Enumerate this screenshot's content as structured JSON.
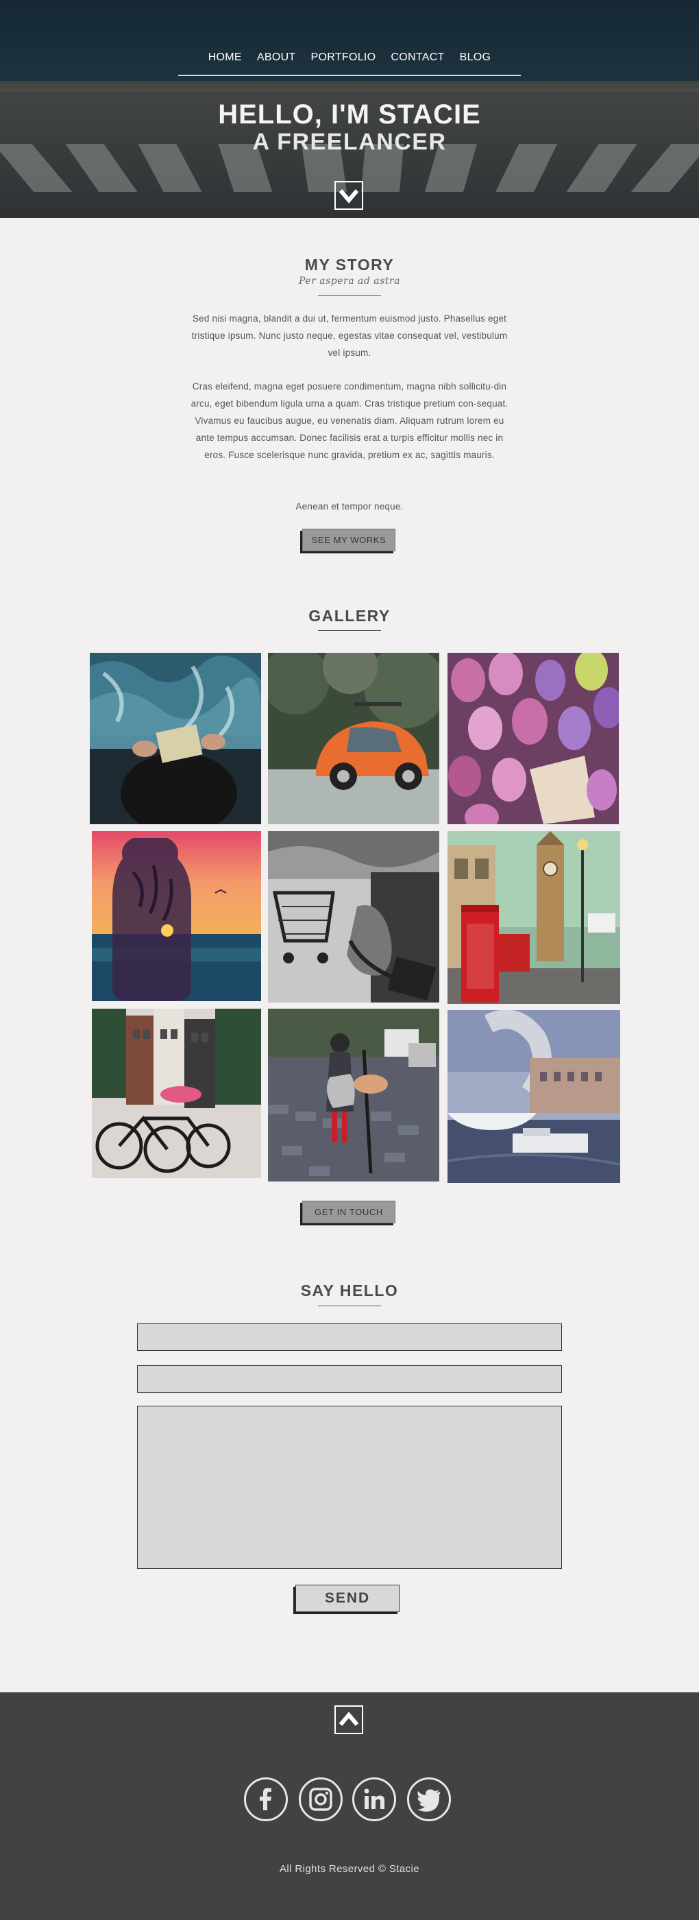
{
  "nav": {
    "items": [
      "HOME",
      "ABOUT",
      "PORTFOLIO",
      "CONTACT",
      "BLOG"
    ]
  },
  "hero": {
    "title": "HELLO, I'M STACIE",
    "subtitle": "A FREELANCER",
    "scroll_down_icon": "chevron-down-icon"
  },
  "story": {
    "title": "MY STORY",
    "motto": "Per aspera ad astra",
    "paragraphs": [
      "Sed nisi magna, blandit a dui ut, fermentum euismod justo. Phasellus eget tristique ipsum. Nunc justo neque, egestas vitae consequat vel, vestibulum vel ipsum.",
      "Cras eleifend, magna eget posuere condimentum, magna nibh sollicitu-din arcu, eget bibendum ligula urna a quam. Cras tristique pretium con-sequat. Vivamus eu faucibus augue, eu venenatis diam. Aliquam rutrum lorem eu ante tempus accumsan. Donec facilisis erat a turpis efficitur mollis nec in eros. Fusce scelerisque nunc gravida, pretium ex ac, sagittis mauris.",
      "Aenean et tempor neque."
    ],
    "button_label": "SEE MY WORKS"
  },
  "gallery": {
    "title": "GALLERY",
    "button_label": "GET IN TOUCH"
  },
  "contact": {
    "title": "SAY HELLO",
    "send_label": "SEND"
  },
  "footer": {
    "scroll_up_icon": "chevron-up-icon",
    "social_icons": [
      "facebook-icon",
      "instagram-icon",
      "linkedin-icon",
      "twitter-icon"
    ],
    "copyright": "All Rights Reserved © Stacie"
  },
  "colors": {
    "background": "#f2f0f1",
    "footer": "#434142",
    "button": "#9a9a9a",
    "field": "#d8d8d8"
  }
}
